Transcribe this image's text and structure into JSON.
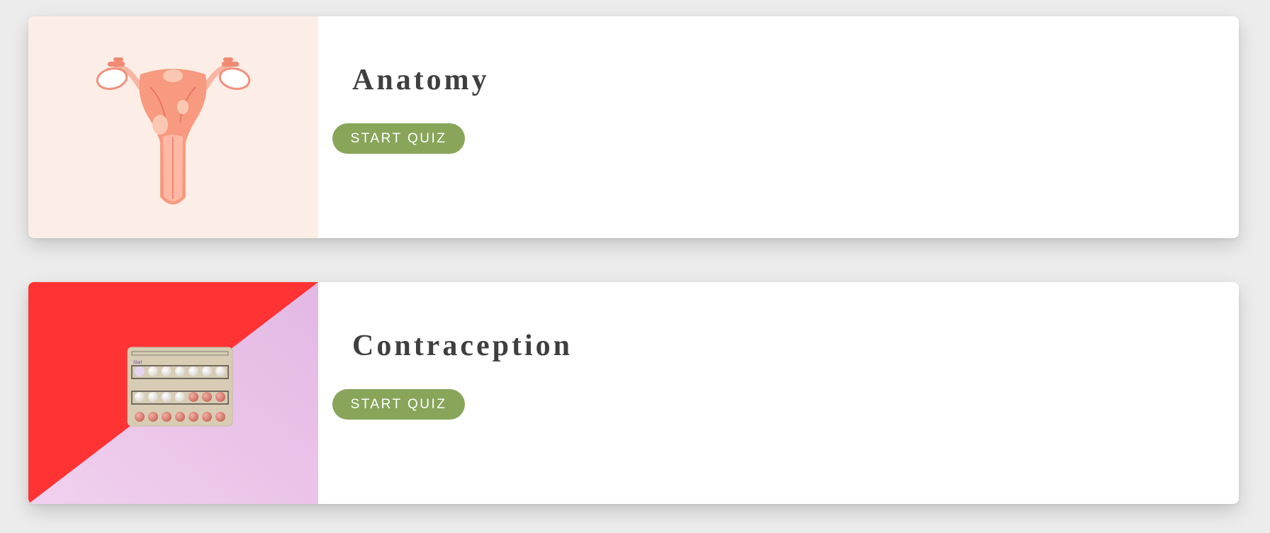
{
  "quizzes": [
    {
      "title": "Anatomy",
      "button_label": "START QUIZ",
      "image_icon": "uterus-illustration",
      "image_bg_color": "#fcede6"
    },
    {
      "title": "Contraception",
      "button_label": "START QUIZ",
      "image_icon": "birth-control-pill-pack",
      "image_bg_colors": [
        "#ff3333",
        "#ebc6e8"
      ],
      "pill_pack_label": "Start"
    }
  ],
  "colors": {
    "button": "#88a55a",
    "title_text": "#3f3f3f",
    "page_background": "#ececec"
  }
}
